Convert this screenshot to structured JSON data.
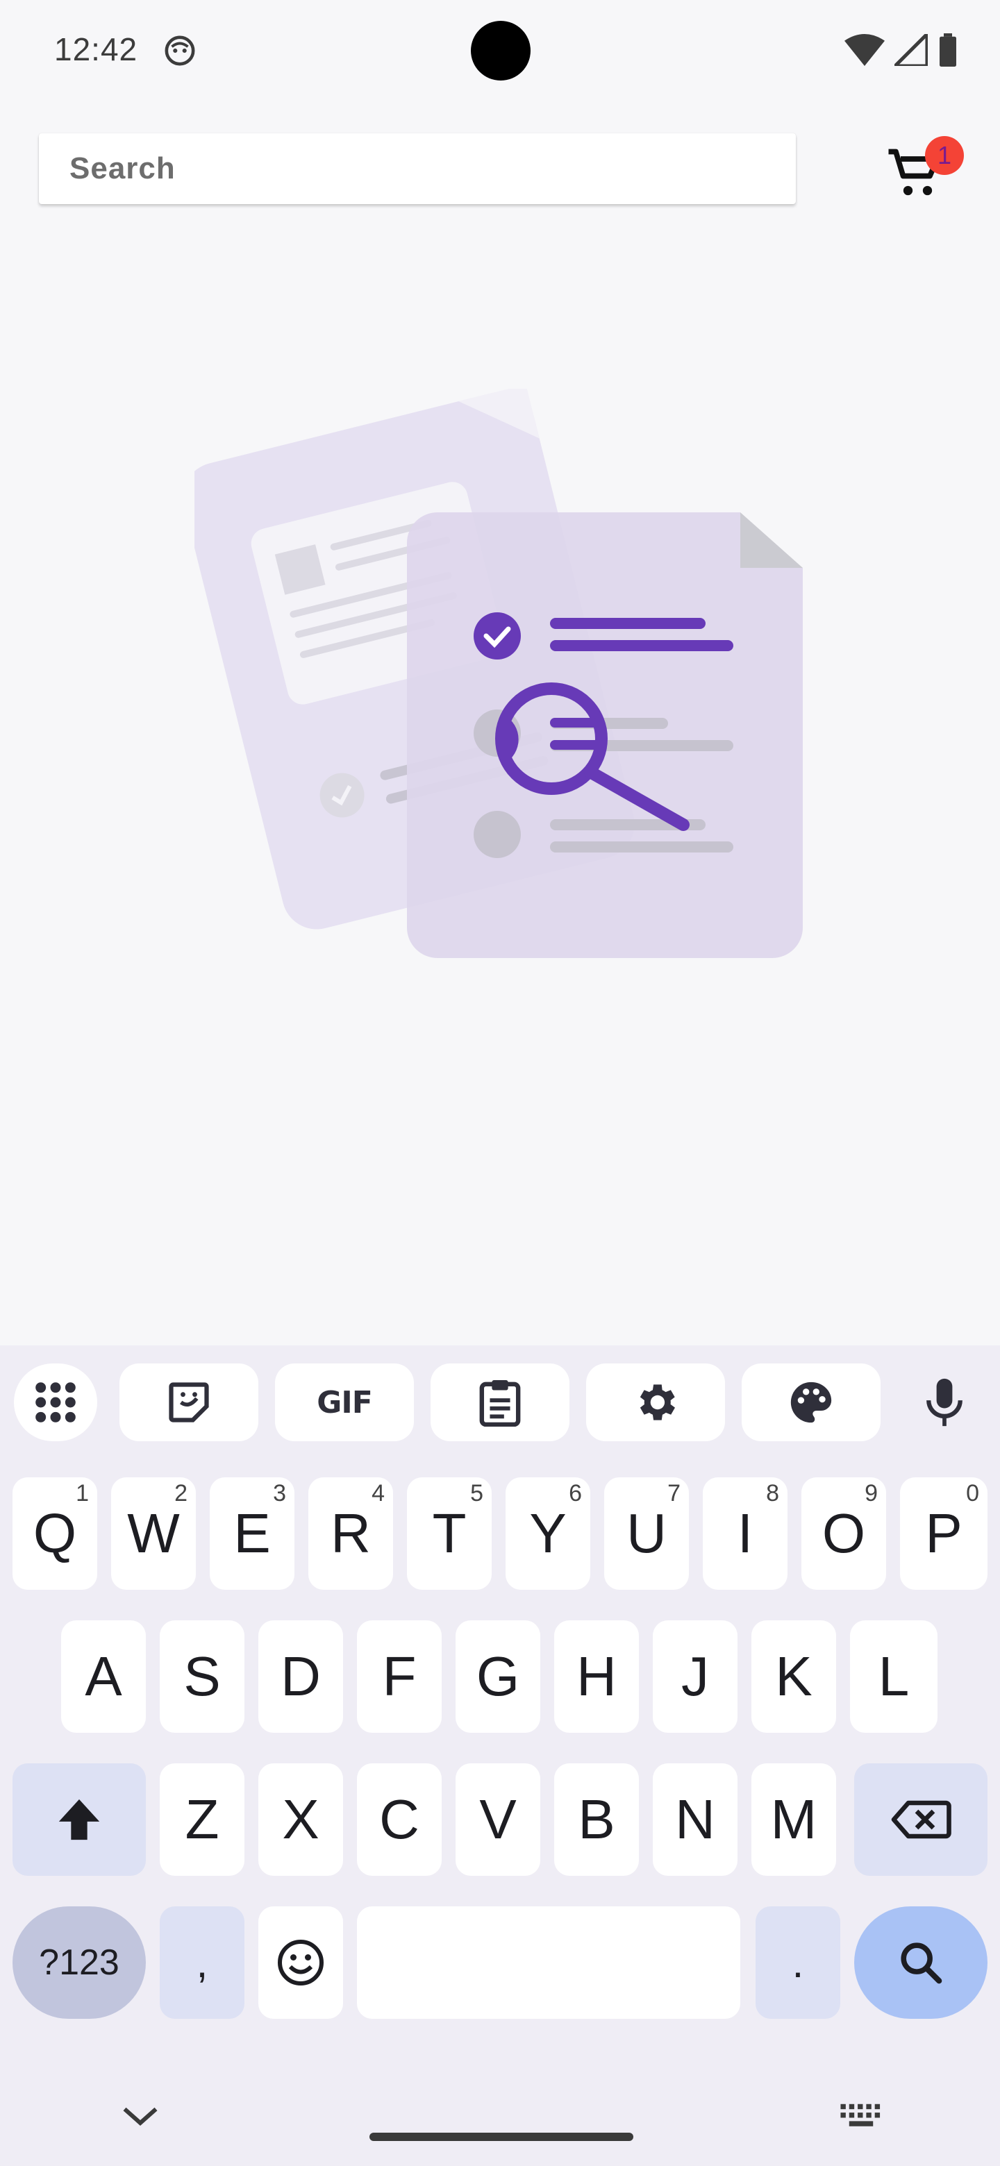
{
  "status_bar": {
    "time": "12:42",
    "app_icon": "android-face-icon",
    "icons": [
      "wifi-icon",
      "signal-icon",
      "battery-icon"
    ]
  },
  "search": {
    "placeholder": "Search",
    "cart_icon": "cart-icon",
    "cart_count": "1"
  },
  "illustration": {
    "name": "empty-search-illustration",
    "accent_color": "#673ab7"
  },
  "keyboard": {
    "toolbar": [
      "apps-grid-icon",
      "sticker-icon",
      "GIF",
      "clipboard-icon",
      "settings-icon",
      "palette-icon",
      "mic-icon"
    ],
    "gif_label": "GIF",
    "row1": [
      {
        "key": "Q",
        "hint": "1"
      },
      {
        "key": "W",
        "hint": "2"
      },
      {
        "key": "E",
        "hint": "3"
      },
      {
        "key": "R",
        "hint": "4"
      },
      {
        "key": "T",
        "hint": "5"
      },
      {
        "key": "Y",
        "hint": "6"
      },
      {
        "key": "U",
        "hint": "7"
      },
      {
        "key": "I",
        "hint": "8"
      },
      {
        "key": "O",
        "hint": "9"
      },
      {
        "key": "P",
        "hint": "0"
      }
    ],
    "row2": [
      "A",
      "S",
      "D",
      "F",
      "G",
      "H",
      "J",
      "K",
      "L"
    ],
    "row3": [
      "Z",
      "X",
      "C",
      "V",
      "B",
      "N",
      "M"
    ],
    "symbols_label": "?123",
    "comma": ",",
    "period": ".",
    "colors": {
      "background": "#efedf5",
      "key": "#ffffff",
      "modifier": "#dde1f4",
      "symbols": "#c1c5dd",
      "enter": "#a9c2f5"
    }
  }
}
